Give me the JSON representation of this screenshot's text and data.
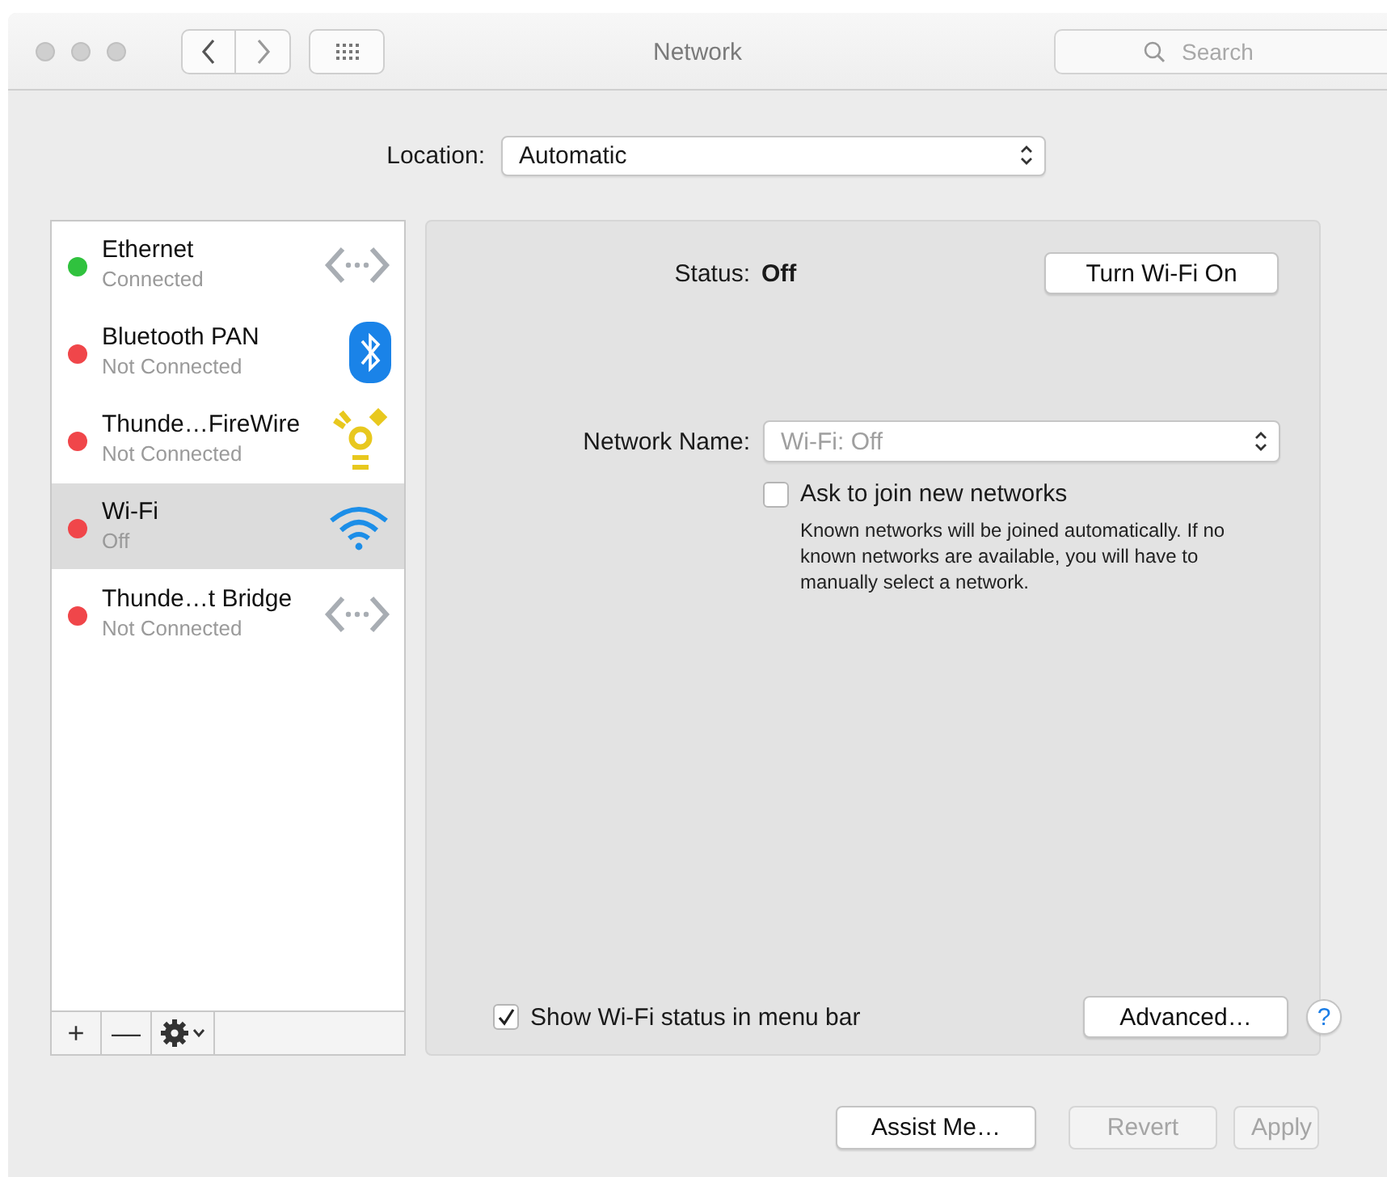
{
  "window": {
    "title": "Network"
  },
  "search": {
    "placeholder": "Search"
  },
  "location": {
    "label": "Location:",
    "value": "Automatic"
  },
  "services": [
    {
      "name": "Ethernet",
      "status": "Connected",
      "color": "#30c23e",
      "kind": "ethernet",
      "selected": false
    },
    {
      "name": "Bluetooth PAN",
      "status": "Not Connected",
      "color": "#f0464a",
      "kind": "bluetooth",
      "selected": false
    },
    {
      "name": "Thunde…FireWire",
      "status": "Not Connected",
      "color": "#f0464a",
      "kind": "firewire",
      "selected": false
    },
    {
      "name": "Wi-Fi",
      "status": "Off",
      "color": "#f0464a",
      "kind": "wifi",
      "selected": true
    },
    {
      "name": "Thunde…t Bridge",
      "status": "Not Connected",
      "color": "#f0464a",
      "kind": "ethernet",
      "selected": false
    }
  ],
  "service_buttons": [
    "+",
    "—"
  ],
  "detail": {
    "status_label": "Status:",
    "status_value": "Off",
    "toggle_button": "Turn Wi-Fi On",
    "network_name_label": "Network Name:",
    "network_name": {
      "value": "Wi-Fi: Off",
      "disabled": true
    },
    "ask_to_join": {
      "label": "Ask to join new networks",
      "checked": false
    },
    "ask_to_join_help": "Known networks will be joined automatically. If no known networks are available, you will have to manually select a network.",
    "show_status": {
      "label": "Show Wi-Fi status in menu bar",
      "checked": true
    },
    "advanced_button": "Advanced…",
    "help_button": "?"
  },
  "buttons": [
    {
      "label": "Assist Me…",
      "disabled": false
    },
    {
      "label": "Revert",
      "disabled": true
    },
    {
      "label": "Apply",
      "disabled": true
    }
  ]
}
